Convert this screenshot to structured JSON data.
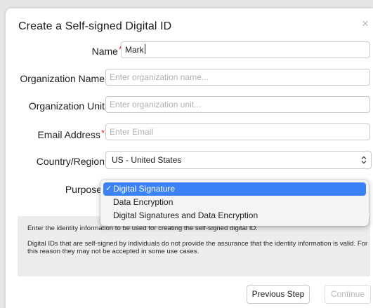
{
  "dialog": {
    "title": "Create a Self-signed Digital ID",
    "close_glyph": "×"
  },
  "form": {
    "name": {
      "label": "Name",
      "required_mark": "*",
      "value": "Mark"
    },
    "org_name": {
      "label": "Organization Name",
      "placeholder": "Enter organization name..."
    },
    "org_unit": {
      "label": "Organization Unit",
      "placeholder": "Enter organization unit..."
    },
    "email": {
      "label": "Email Address",
      "required_mark": "*",
      "placeholder": "Enter Email"
    },
    "country": {
      "label": "Country/Region",
      "value": "US - United States",
      "arrow_glyph": "⌃⌄"
    },
    "purpose": {
      "label": "Purpose"
    }
  },
  "purpose_dropdown": {
    "check_glyph": "✓",
    "options": [
      {
        "label": "Digital Signature",
        "selected": true
      },
      {
        "label": "Data Encryption",
        "selected": false
      },
      {
        "label": "Digital Signatures and Data Encryption",
        "selected": false
      }
    ]
  },
  "info": {
    "line1": "Enter the identity information to be used for creating the self-signed digital ID.",
    "line2": "Digital IDs that are self-signed by individuals do not provide the assurance that the identity information is valid. For this reason they may not be accepted in some use cases."
  },
  "buttons": {
    "previous": "Previous Step",
    "continue": "Continue"
  },
  "colors": {
    "accent": "#3b82f6",
    "required": "#e22b2b"
  }
}
